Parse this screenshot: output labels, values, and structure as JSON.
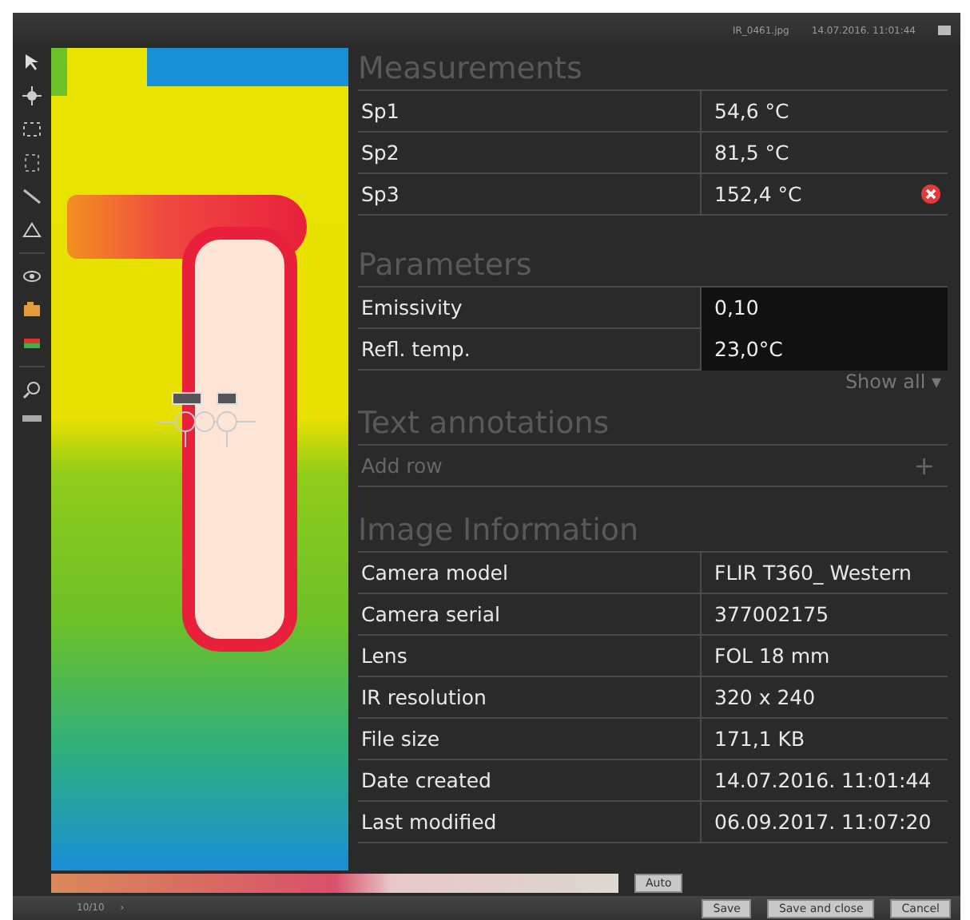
{
  "title_bar": {
    "file_name": "IR_0461.jpg",
    "timestamp": "14.07.2016. 11:01:44"
  },
  "measurements": {
    "title": "Measurements",
    "rows": [
      {
        "label": "Sp1",
        "value": "54,6 °C",
        "alarm": false
      },
      {
        "label": "Sp2",
        "value": "81,5 °C",
        "alarm": false
      },
      {
        "label": "Sp3",
        "value": "152,4 °C",
        "alarm": true
      }
    ]
  },
  "parameters": {
    "title": "Parameters",
    "rows": [
      {
        "label": "Emissivity",
        "value": "0,10"
      },
      {
        "label": "Refl. temp.",
        "value": "23,0°C"
      }
    ],
    "show_all": "Show all ▾"
  },
  "text_annotations": {
    "title": "Text annotations",
    "add_row": "Add row",
    "add_icon": "+"
  },
  "image_information": {
    "title": "Image Information",
    "rows": [
      {
        "label": "Camera model",
        "value": "FLIR T360_ Western"
      },
      {
        "label": "Camera serial",
        "value": "377002175"
      },
      {
        "label": "Lens",
        "value": "FOL 18 mm"
      },
      {
        "label": "IR resolution",
        "value": "320 x 240"
      },
      {
        "label": "File size",
        "value": "171,1 KB"
      },
      {
        "label": "Date created",
        "value": "14.07.2016. 11:01:44"
      },
      {
        "label": "Last modified",
        "value": "06.09.2017. 11:07:20"
      }
    ]
  },
  "palette_bar": {
    "auto_button": "Auto"
  },
  "footer": {
    "page": "10/10",
    "next": "›",
    "buttons": [
      "Save",
      "Save and close",
      "Cancel"
    ]
  }
}
